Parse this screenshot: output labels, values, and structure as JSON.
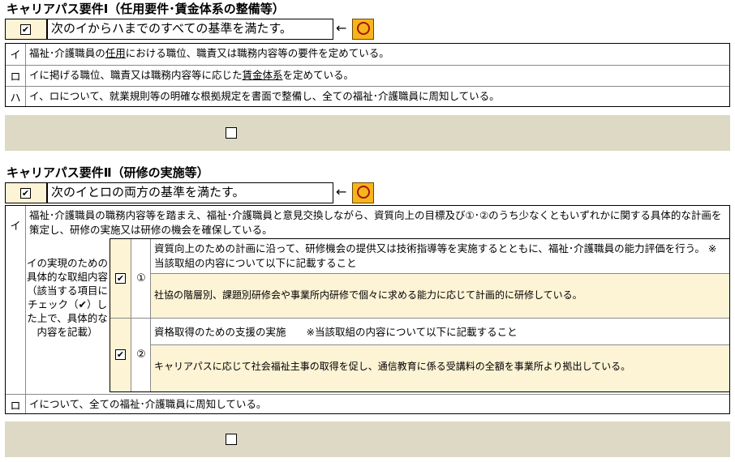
{
  "section1": {
    "title": "キャリアパス要件Ⅰ（任用要件･賃金体系の整備等）",
    "check_mark": "✔",
    "statement": "次のイからハまでのすべての基準を満たす。",
    "arrow": "←",
    "rows": [
      {
        "letter": "イ",
        "pre": "福祉･介護職員の",
        "link": "任用",
        "post": "における職位、職責又は職務内容等の要件を定めている。"
      },
      {
        "letter": "ロ",
        "pre": "イに掲げる職位、職責又は職務内容等に応じた",
        "link": "賃金体系",
        "post": "を定めている。"
      },
      {
        "letter": "ハ",
        "pre": "イ、ロについて、就業規則等の明確な根拠規定を書面で整備し、全ての福祉･介護職員に周知している。",
        "link": "",
        "post": ""
      }
    ]
  },
  "section2": {
    "title": "キャリアパス要件Ⅱ（研修の実施等）",
    "check_mark": "✔",
    "statement": "次のイとロの両方の基準を満たす。",
    "arrow": "←",
    "row_i": {
      "letter": "イ",
      "text": "福祉･介護職員の職務内容等を踏まえ、福祉･介護職員と意見交換しながら、資質向上の目標及び①･②のうち少なくともいずれかに関する具体的な計画を策定し、研修の実施又は研修の機会を確保している。"
    },
    "side_label": "イの実現のための具体的な取組内容（該当する項目にチェック（✔）した上で、具体的な内容を記載）",
    "items": [
      {
        "check": "✔",
        "num": "①",
        "heading": "資質向上のための計画に沿って、研修機会の提供又は技術指導等を実施するとともに、福祉･介護職員の能力評価を行う。 ※当該取組の内容について以下に記載すること",
        "detail": "社協の階層別、課題別研修会や事業所内研修で個々に求める能力に応じて計画的に研修している。"
      },
      {
        "check": "✔",
        "num": "②",
        "heading": "資格取得のための支援の実施　　※当該取組の内容について以下に記載すること",
        "detail": "キャリアパスに応じて社会福祉主事の取得を促し、通信教育に係る受講料の全額を事業所より拠出している。"
      }
    ],
    "row_ro": {
      "letter": "ロ",
      "text": "イについて、全ての福祉･介護職員に周知している。"
    }
  },
  "colors": {
    "band": "#ddd9c4",
    "yellow_cell": "#fdf3d5",
    "orange_cell": "#f7b51c",
    "circle": "#a31515"
  }
}
